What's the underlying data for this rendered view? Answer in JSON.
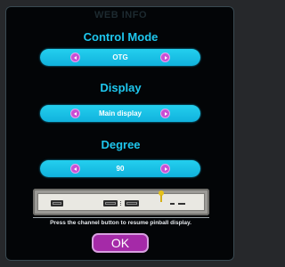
{
  "dialog": {
    "ghost_title": "WEB INFO",
    "sections": [
      {
        "title": "Control Mode",
        "value": "OTG"
      },
      {
        "title": "Display",
        "value": "Main display"
      },
      {
        "title": "Degree",
        "value": "90"
      }
    ],
    "hint": "Press the channel button to resume pinball display.",
    "ok_label": "OK"
  },
  "colors": {
    "accent": "#1ec7ee",
    "selector": "#1bbfe6",
    "arrow": "#c94fd4",
    "ok_button": "#a52aa8",
    "background": "#030507"
  },
  "icons": [
    "chevron-left-icon",
    "chevron-right-icon",
    "port-icon",
    "indicator-pin-icon"
  ]
}
